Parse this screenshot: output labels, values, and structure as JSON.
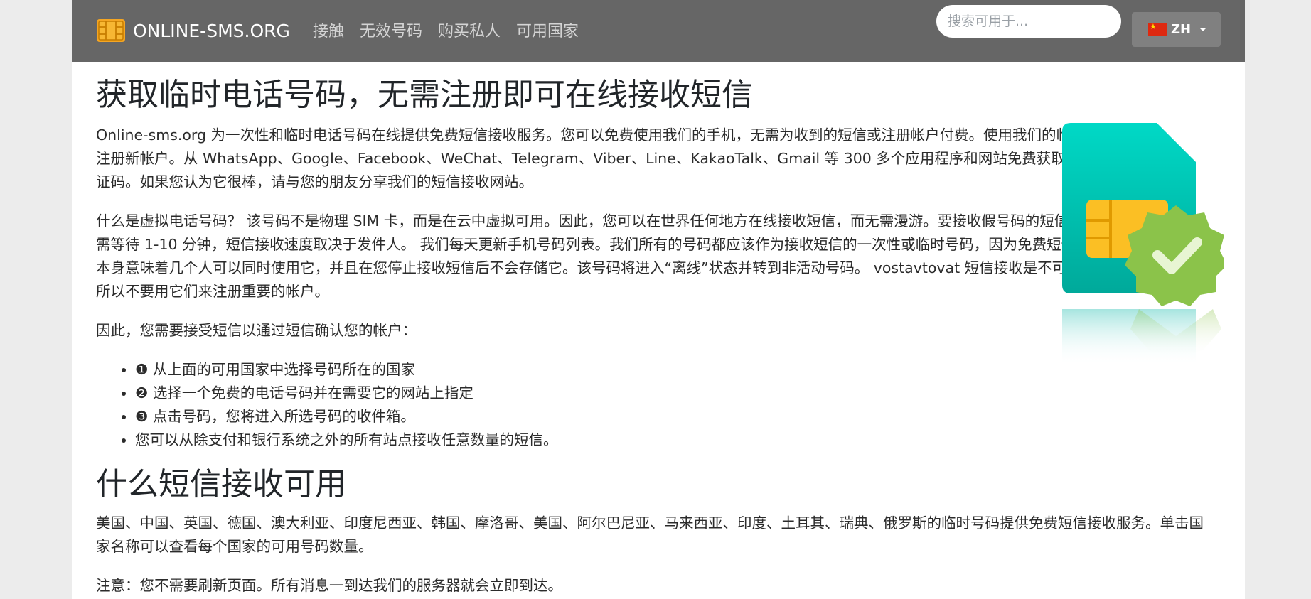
{
  "navbar": {
    "brand": "ONLINE-SMS.ORG",
    "links": [
      "接触",
      "无效号码",
      "购买私人",
      "可用国家"
    ],
    "search_placeholder": "搜索可用于...",
    "language": "ZH"
  },
  "main": {
    "title": "获取临时电话号码，无需注册即可在线接收短信",
    "intro_p1": "Online-sms.org 为一次性和临时电话号码在线提供免费短信接收服务。您可以免费使用我们的手机，无需为收到的短信或注册帐户付费。使用我们的临时号码注册新帐户。从 WhatsApp、Google、Facebook、WeChat、Telegram、Viber、Line、KakaoTalk、Gmail 等 300 多个应用程序和网站免费获取短信验证码。如果您认为它很棒，请与您的朋友分享我们的短信接收网站。",
    "intro_p2": "什么是虚拟电话号码？ 该号码不是物理 SIM 卡，而是在云中虚拟可用。因此，您可以在世界任何地方在线接收短信，而无需漫游。要接收假号码的短信，您只需等待 1-10 分钟，短信接收速度取决于发件人。 我们每天更新手机号码列表。我们所有的号码都应该作为接收短信的一次性或临时号码，因为免费短信的数量本身意味着几个人可以同时使用它，并且在您停止接收短信后不会存储它。该号码将进入“离线”状态并转到非活动号码。 vostavtovat 短信接收是不可能的。所以不要用它们来注册重要的帐户。",
    "intro_p3": "因此，您需要接受短信以通过短信确认您的帐户：",
    "steps": [
      "❶ 从上面的可用国家中选择号码所在的国家",
      "❷ 选择一个免费的电话号码并在需要它的网站上指定",
      "❸ 点击号码，您将进入所选号码的收件箱。",
      "您可以从除支付和银行系统之外的所有站点接收任意数量的短信。"
    ],
    "section2_title": "什么短信接收可用",
    "section2_p1": "美国、中国、英国、德国、澳大利亚、印度尼西亚、韩国、摩洛哥、美国、阿尔巴尼亚、马来西亚、印度、土耳其、瑞典、俄罗斯的临时号码提供免费短信接收服务。单击国家名称可以查看每个国家的可用号码数量。",
    "section2_p2": "注意：您不需要刷新页面。所有消息一到达我们的服务器就会立即到达。"
  },
  "colors": {
    "navbar_bg": "#666666",
    "lang_button_bg": "#808080",
    "sim_teal": "#14b8a6",
    "sim_chip": "#fbbf24",
    "badge_green": "#8bc34a"
  }
}
